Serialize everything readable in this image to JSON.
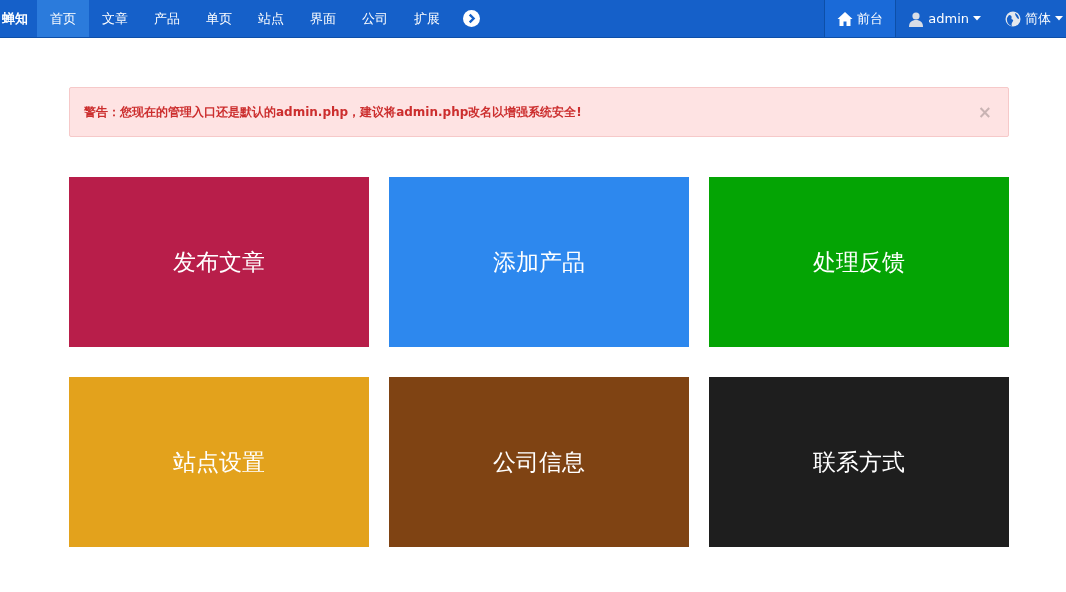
{
  "navbar": {
    "brand": "蝉知",
    "items": [
      {
        "label": "首页",
        "selected": true
      },
      {
        "label": "文章",
        "selected": false
      },
      {
        "label": "产品",
        "selected": false
      },
      {
        "label": "单页",
        "selected": false
      },
      {
        "label": "站点",
        "selected": false
      },
      {
        "label": "界面",
        "selected": false
      },
      {
        "label": "公司",
        "selected": false
      },
      {
        "label": "扩展",
        "selected": false
      }
    ],
    "right_items": [
      {
        "kind": "home",
        "label": "前台",
        "selected": true,
        "dropdown": false
      },
      {
        "kind": "user",
        "label": "admin",
        "selected": false,
        "dropdown": true
      },
      {
        "kind": "globe",
        "label": "简体",
        "selected": false,
        "dropdown": true
      }
    ]
  },
  "alert": {
    "text": "警告：您现在的管理入口还是默认的admin.php，建议将admin.php改名以增强系统安全!",
    "close": "×"
  },
  "tiles": [
    {
      "label": "发布文章",
      "color": "#b81e4a"
    },
    {
      "label": "添加产品",
      "color": "#2d88ee"
    },
    {
      "label": "处理反馈",
      "color": "#04a404"
    },
    {
      "label": "站点设置",
      "color": "#e3a21c"
    },
    {
      "label": "公司信息",
      "color": "#7f4313"
    },
    {
      "label": "联系方式",
      "color": "#1e1e1e"
    }
  ]
}
